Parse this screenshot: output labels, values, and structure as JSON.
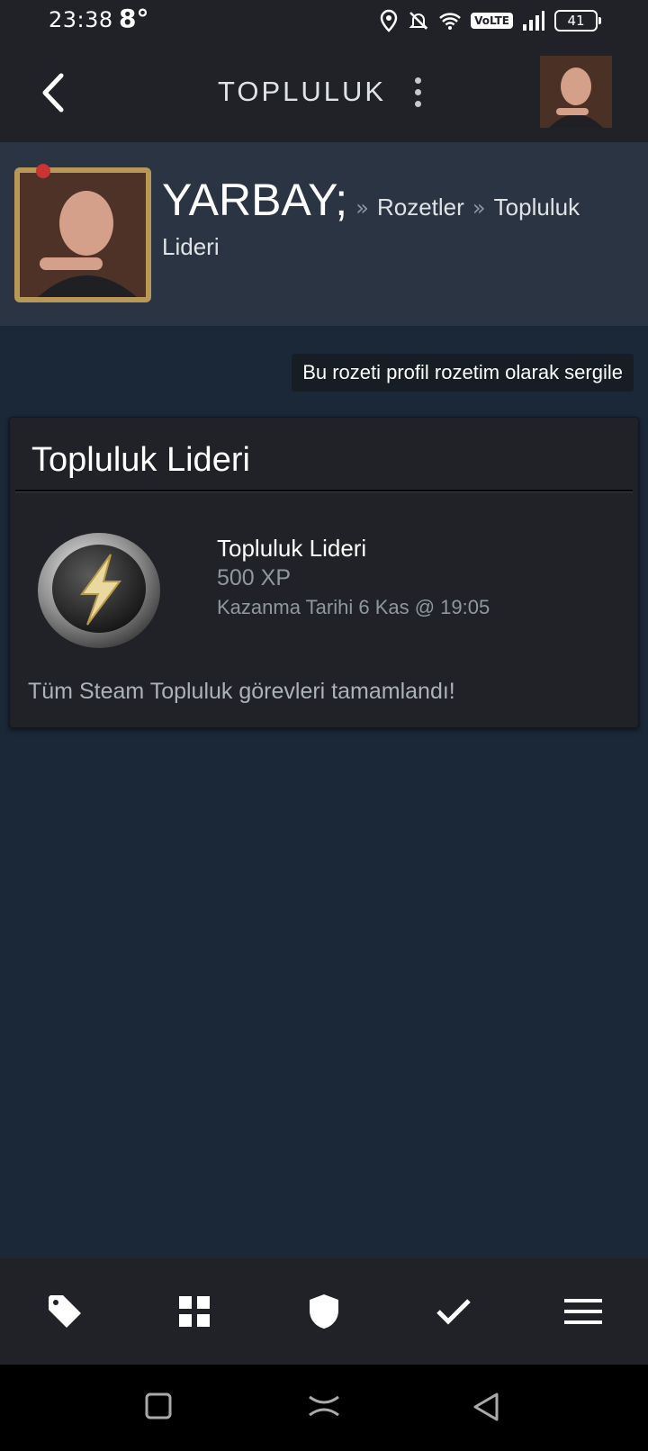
{
  "status_bar": {
    "time": "23:38",
    "temperature": "8°",
    "network_badge": "VoLTE",
    "battery": "41"
  },
  "app_bar": {
    "title": "TOPLULUK",
    "back_icon": "chevron-left-icon",
    "menu_icon": "more-vertical-icon"
  },
  "profile": {
    "name": "YARBAY;",
    "separator": "»",
    "crumb_badges": "Rozetler",
    "crumb_badge": "Topluluk Lideri"
  },
  "showcase_button": "Bu rozeti profil rozetim olarak sergile",
  "badge": {
    "card_title": "Topluluk Lideri",
    "name": "Topluluk Lideri",
    "xp": "500 XP",
    "earned": "Kazanma Tarihi 6 Kas @ 19:05",
    "description": "Tüm Steam Topluluk görevleri tamamlandı!"
  },
  "bottom_nav": [
    "tag-icon",
    "grid-icon",
    "shield-icon",
    "check-icon",
    "menu-icon"
  ],
  "system_nav": [
    "recents-icon",
    "home-icon",
    "back-icon"
  ],
  "colors": {
    "background": "#1b2838",
    "header": "#202227",
    "profile_band": "#2a3443",
    "muted_text": "#8f98a0"
  }
}
